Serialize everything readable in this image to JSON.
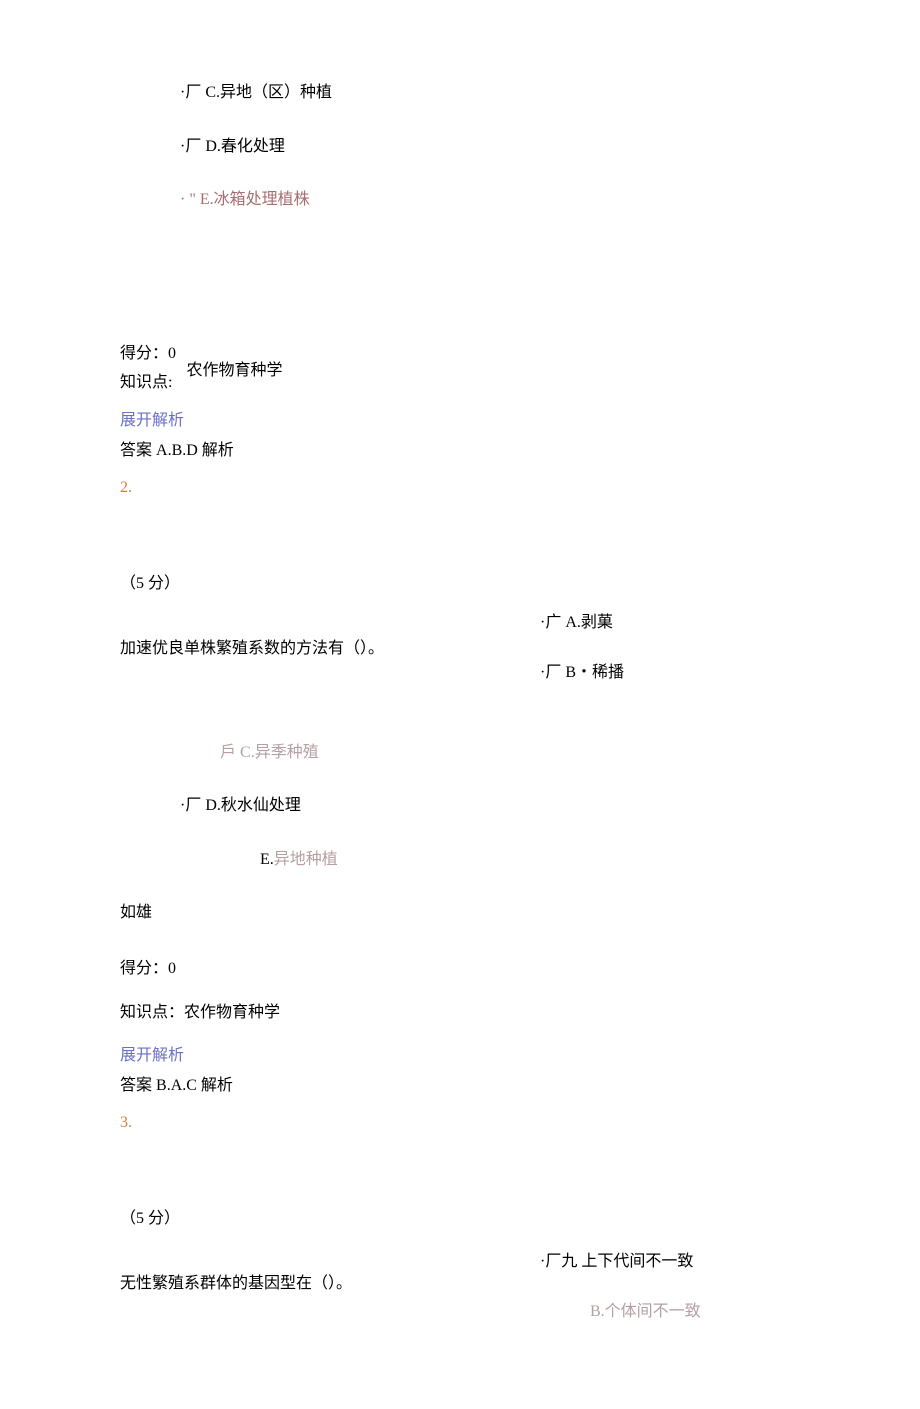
{
  "q1": {
    "optC": {
      "prefix": "·厂",
      "letter": "C.",
      "text": "异地（区）种植"
    },
    "optD": {
      "prefix": "·厂",
      "letter": "D.",
      "text": "春化处理"
    },
    "optE": {
      "prefix": "· \"",
      "letter": "E.",
      "text": "冰箱处理植株"
    },
    "score_label": "得分：",
    "score_value": "0",
    "knowledge_label": "知识点:",
    "knowledge_value": "农作物育种学",
    "expand": "展开解析",
    "answer_label": "答案",
    "answer_value": "A.B.D",
    "analysis_label": "解析"
  },
  "q2": {
    "num": "2.",
    "points": "（5 分）",
    "stem": "加速优良单株繁殖系数的方法有（）。",
    "optA": {
      "prefix": "·广",
      "letter": "A.",
      "text": "剥菓"
    },
    "optB": {
      "prefix": "·厂",
      "letter": "B",
      "dot": "・",
      "text": "稀播"
    },
    "optC": {
      "prefix": "戶",
      "letter": "C.",
      "text": "异季种殖"
    },
    "optD": {
      "prefix": "·厂",
      "letter": "D.",
      "text": "秋水仙处理"
    },
    "optE": {
      "letter": "E.",
      "text": "异地种植"
    },
    "tail": "如雄",
    "score_label": "得分：",
    "score_value": "0",
    "knowledge_label": "知识点：",
    "knowledge_value": "农作物育种学",
    "expand": "展开解析",
    "answer_label": "答案",
    "answer_value": "B.A.C",
    "analysis_label": "解析"
  },
  "q3": {
    "num": "3.",
    "points": "（5 分）",
    "stem": "无性繁殖系群体的基因型在（）。",
    "optA": {
      "prefix": "·厂九",
      "text": "上下代间不一致"
    },
    "optB": {
      "letter": "B.",
      "text": "个体间不一致"
    }
  }
}
